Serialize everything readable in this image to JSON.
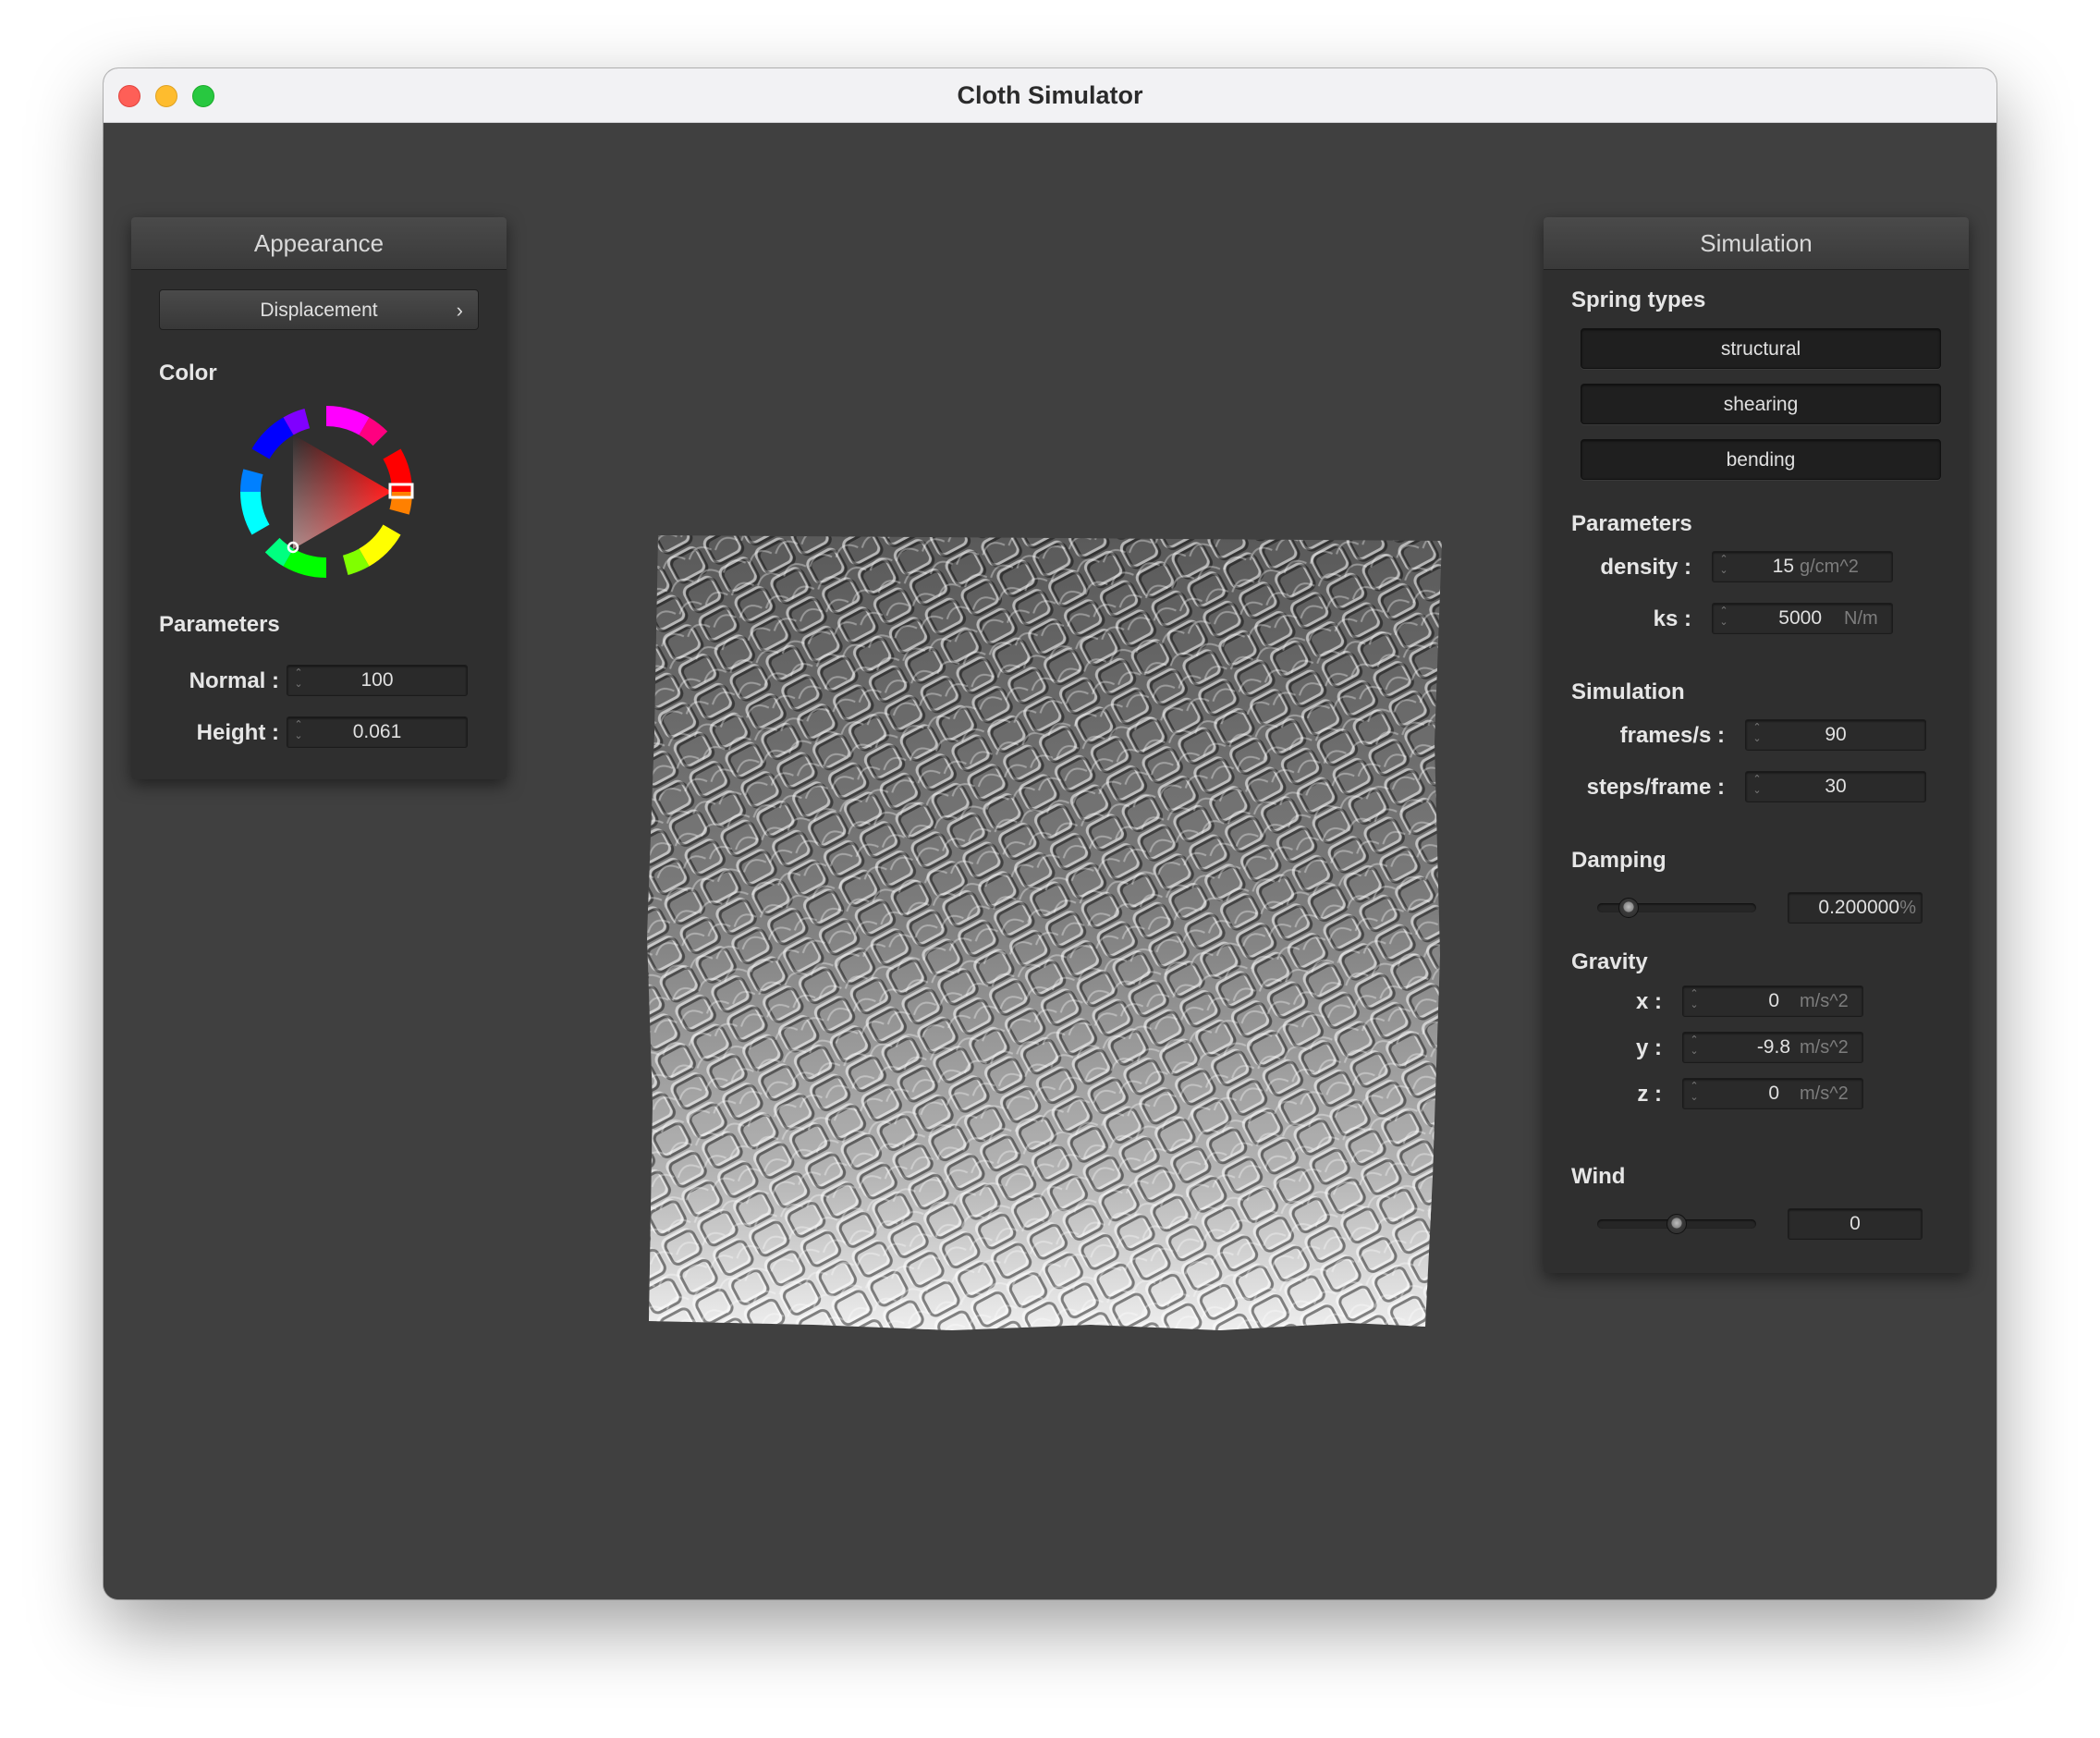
{
  "window": {
    "title": "Cloth Simulator"
  },
  "appearance": {
    "header": "Appearance",
    "shader_button": "Displacement",
    "color_label": "Color",
    "params_label": "Parameters",
    "normal_label": "Normal :",
    "normal_value": "100",
    "height_label": "Height :",
    "height_value": "0.061",
    "selected_hue": "#ff0000"
  },
  "simulation": {
    "header": "Simulation",
    "spring_types_label": "Spring types",
    "spring_buttons": [
      "structural",
      "shearing",
      "bending"
    ],
    "params_label": "Parameters",
    "density_label": "density :",
    "density_value": "15",
    "density_unit": "g/cm^2",
    "ks_label": "ks :",
    "ks_value": "5000",
    "ks_unit": "N/m",
    "sim_label": "Simulation",
    "fps_label": "frames/s :",
    "fps_value": "90",
    "steps_label": "steps/frame :",
    "steps_value": "30",
    "damping_label": "Damping",
    "damping_value": "0.200000",
    "damping_unit": "%",
    "damping_slider_fraction": 0.2,
    "gravity_label": "Gravity",
    "gx_label": "x :",
    "gx_value": "0",
    "gy_label": "y :",
    "gy_value": "-9.8",
    "gz_label": "z :",
    "gz_value": "0",
    "gravity_unit": "m/s^2",
    "wind_label": "Wind",
    "wind_value": "0",
    "wind_slider_fraction": 0.5
  }
}
